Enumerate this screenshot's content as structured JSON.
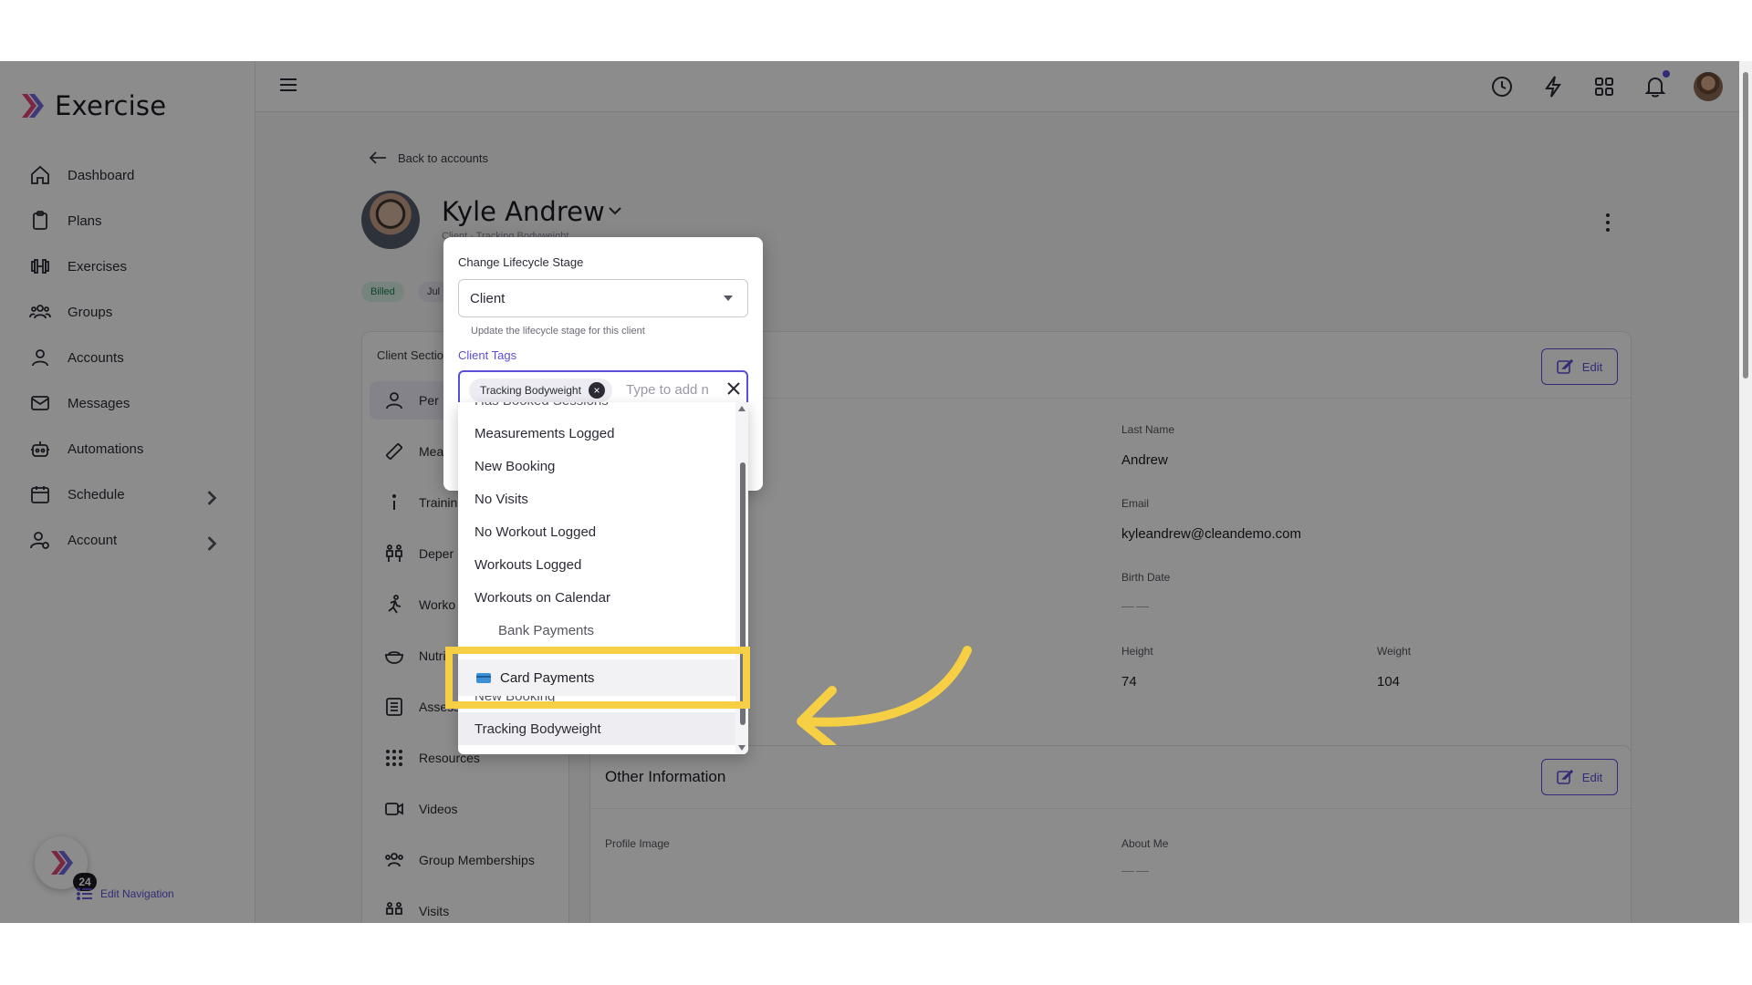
{
  "app": {
    "name": "Exercise"
  },
  "colors": {
    "accent": "#5b4fd6",
    "highlight": "#f6cf44",
    "billed_bg": "#d7f1e3"
  },
  "sidebar": {
    "items": [
      {
        "label": "Dashboard",
        "icon": "home-icon"
      },
      {
        "label": "Plans",
        "icon": "clipboard-icon"
      },
      {
        "label": "Exercises",
        "icon": "dumbbell-icon"
      },
      {
        "label": "Groups",
        "icon": "users-icon"
      },
      {
        "label": "Accounts",
        "icon": "user-icon"
      },
      {
        "label": "Messages",
        "icon": "mail-icon"
      },
      {
        "label": "Automations",
        "icon": "robot-icon"
      },
      {
        "label": "Schedule",
        "icon": "calendar-icon",
        "has_submenu": true
      },
      {
        "label": "Account",
        "icon": "user-gear-icon",
        "has_submenu": true
      }
    ],
    "widget_badge": "24",
    "edit_navigation": "Edit Navigation"
  },
  "topbar": {
    "icons": [
      "history-icon",
      "bolt-icon",
      "grid-icon",
      "bell-icon",
      "avatar"
    ]
  },
  "page": {
    "back_label": "Back to accounts",
    "name": "Kyle Andrew",
    "subtitle": "Client · Tracking Bodyweight",
    "badges": [
      "Billed",
      "Jul"
    ]
  },
  "client_sections": {
    "title": "Client Sectio",
    "items": [
      "Per",
      "Measu",
      "Trainin",
      "Deper",
      "Worko",
      "Nutri",
      "Assess",
      "Resources",
      "Videos",
      "Group Memberships",
      "Visits"
    ]
  },
  "details": {
    "edit_label": "Edit",
    "last_name_label": "Last Name",
    "last_name": "Andrew",
    "email_label": "Email",
    "email": "kyleandrew@cleandemo.com",
    "birth_date_label": "Birth Date",
    "birth_date": "——",
    "height_label": "Height",
    "height": "74",
    "weight_label": "Weight",
    "weight": "104"
  },
  "other_info": {
    "title": "Other Information",
    "edit_label": "Edit",
    "profile_image_label": "Profile Image",
    "about_me_label": "About Me",
    "about_me": "——"
  },
  "popover": {
    "lifecycle_label": "Change Lifecycle Stage",
    "lifecycle_value": "Client",
    "lifecycle_helper": "Update the lifecycle stage for this client",
    "tags_label": "Client Tags",
    "tag_chip": "Tracking Bodyweight",
    "tags_placeholder": "Type to add n"
  },
  "dropdown": {
    "options": [
      "Has Booked Sessions",
      "Measurements Logged",
      "New Booking",
      "No Visits",
      "No Workout Logged",
      "Workouts Logged",
      "Workouts on Calendar",
      "Bank Payments",
      "Card Payments",
      "New Booking",
      "Tracking Bodyweight"
    ],
    "highlighted": "Card Payments"
  }
}
